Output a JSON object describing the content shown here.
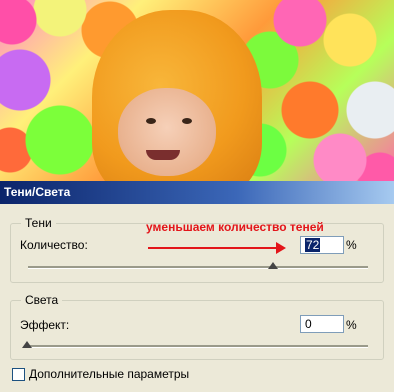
{
  "dialog": {
    "title": "Тени/Света",
    "shadows": {
      "legend": "Тени",
      "amount_label": "Количество:",
      "amount_value": "72",
      "unit": "%",
      "slider_value_percent": 72
    },
    "highlights": {
      "legend": "Света",
      "effect_label": "Эффект:",
      "effect_value": "0",
      "unit": "%",
      "slider_value_percent": 0
    },
    "more_options": {
      "label": "Дополнительные параметры",
      "checked": false
    }
  },
  "annotation": {
    "text": "уменьшаем количество теней",
    "color": "#e3151a"
  }
}
